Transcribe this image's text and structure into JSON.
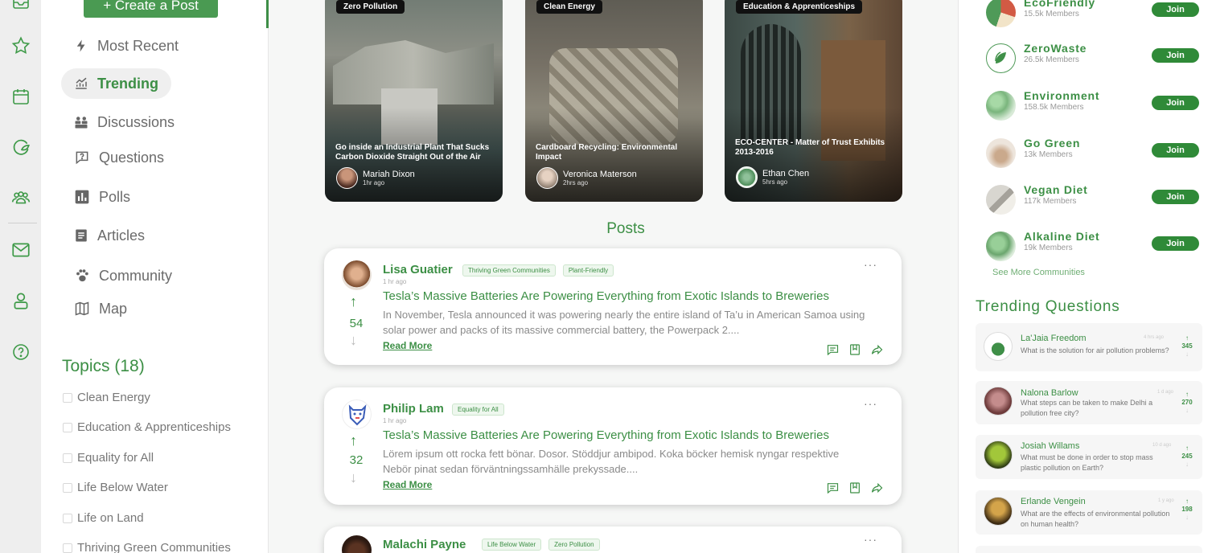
{
  "colors": {
    "brand": "#3c8f45",
    "join": "#2f8a38",
    "rail_bg": "#eeeeee"
  },
  "rail": {
    "icons": [
      "inbox-icon",
      "star-icon",
      "calendar-icon",
      "leaf-cycle-icon",
      "people-icon",
      "mail-icon",
      "user-icon",
      "help-icon"
    ]
  },
  "leftnav": {
    "create_label": "+ Create a Post",
    "items": [
      {
        "label": "Most Recent",
        "icon": "lightning-icon"
      },
      {
        "label": "Trending",
        "icon": "trending-chart-icon"
      },
      {
        "label": "Discussions",
        "icon": "discussions-icon"
      },
      {
        "label": "Questions",
        "icon": "question-bubble-icon"
      },
      {
        "label": "Polls",
        "icon": "polls-icon"
      },
      {
        "label": "Articles",
        "icon": "article-icon"
      },
      {
        "label": "Community",
        "icon": "paw-icon"
      },
      {
        "label": "Map",
        "icon": "map-icon"
      }
    ],
    "topics_title": "Topics (18)",
    "topics": [
      "Clean Energy",
      "Education &  Apprenticeships",
      "Equality for All",
      "Life Below Water",
      "Life on Land",
      "Thriving Green Communities"
    ]
  },
  "featured": [
    {
      "tag": "Zero Pollution",
      "title": "Go inside an Industrial Plant That Sucks Carbon Dioxide Straight Out of the Air",
      "author": "Mariah Dixon",
      "time": "1hr ago"
    },
    {
      "tag": "Clean Energy",
      "title": "Cardboard Recycling: Environmental Impact",
      "author": "Veronica Materson",
      "time": "2hrs ago"
    },
    {
      "tag": "Education & Apprenticeships",
      "title": "ECO-CENTER - Matter of Trust Exhibits 2013-2016",
      "author": "Ethan Chen",
      "time": "5hrs ago"
    }
  ],
  "posts_heading": "Posts",
  "posts": [
    {
      "author": "Lisa Guatier",
      "tags": [
        "Thriving Green Communities",
        "Plant-Friendly"
      ],
      "time": "1 hr ago",
      "votes": "54",
      "title": "Tesla’s Massive Batteries Are Powering Everything from Exotic Islands to Breweries",
      "body": "In November, Tesla announced it was powering nearly the entire island of Ta’u in American Samoa using solar power and packs of its massive commercial battery, the Powerpack 2....",
      "read_more": "Read More",
      "more": "···"
    },
    {
      "author": "Philip Lam",
      "tags": [
        "Equality for All"
      ],
      "time": "1 hr ago",
      "votes": "32",
      "title": "Tesla’s Massive Batteries Are Powering Everything from Exotic Islands to Breweries",
      "body": "Lörem ipsum ott rocka fett bönar. Dosor. Stöddjur ambipod. Koka böcker hemisk nyngar respektive Nebör pinat sedan förväntningssamhälle prekyssade....",
      "read_more": "Read More",
      "more": "···"
    },
    {
      "author": "Malachi Payne",
      "tags": [
        "Life Below Water",
        "Zero Pollution"
      ],
      "more": "···"
    }
  ],
  "communities": [
    {
      "name": "EcoFriendly",
      "members": "15.5k  Members",
      "join": "Join"
    },
    {
      "name": "ZeroWaste",
      "members": "26.5k  Members",
      "join": "Join"
    },
    {
      "name": "Environment",
      "members": "158.5k  Members",
      "join": "Join"
    },
    {
      "name": "Go Green",
      "members": "13k  Members",
      "join": "Join"
    },
    {
      "name": "Vegan Diet",
      "members": "117k  Members",
      "join": "Join"
    },
    {
      "name": "Alkaline Diet",
      "members": "19k  Members",
      "join": "Join"
    }
  ],
  "see_more": "See More Communities",
  "trending_title": "Trending Questions",
  "questions": [
    {
      "name": "La'Jaia Freedom",
      "time": "4 hrs ago",
      "question": "What is the solution for air pollution problems?",
      "votes": "345"
    },
    {
      "name": "Nalona Barlow",
      "time": "1 d ago",
      "question": "What steps can be taken to make Delhi a pollution free city?",
      "votes": "270"
    },
    {
      "name": "Josiah Willams",
      "time": "10 d ago",
      "question": "What must be done in order to stop mass plastic pollution on Earth?",
      "votes": "245"
    },
    {
      "name": "Erlande Vengein",
      "time": "1 y ago",
      "question": "What are the effects of environmental pollution on human health?",
      "votes": "198"
    }
  ]
}
